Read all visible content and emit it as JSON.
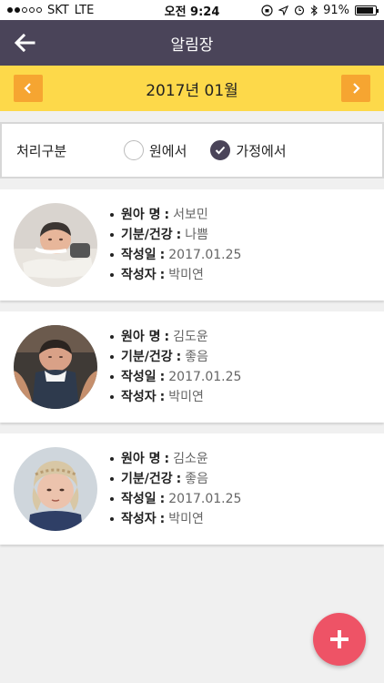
{
  "status_bar": {
    "carrier": "SKT",
    "network": "LTE",
    "time": "오전 9:24",
    "battery_percent": "91%",
    "battery_level": 0.91
  },
  "header": {
    "title": "알림장",
    "back_icon": "arrow-left-icon"
  },
  "month_nav": {
    "label": "2017년 01월",
    "prev_icon": "chevron-left-icon",
    "next_icon": "chevron-right-icon"
  },
  "filter": {
    "label": "처리구분",
    "options": [
      {
        "label": "원에서",
        "checked": false
      },
      {
        "label": "가정에서",
        "checked": true
      }
    ]
  },
  "field_labels": {
    "name": "원아 명",
    "mood": "기분/건강",
    "date": "작성일",
    "author": "작성자"
  },
  "entries": [
    {
      "name": "서보민",
      "mood": "나쁨",
      "date": "2017.01.25",
      "author": "박미연"
    },
    {
      "name": "김도윤",
      "mood": "좋음",
      "date": "2017.01.25",
      "author": "박미연"
    },
    {
      "name": "김소윤",
      "mood": "좋음",
      "date": "2017.01.25",
      "author": "박미연"
    }
  ],
  "fab": {
    "icon": "plus-icon"
  },
  "colors": {
    "header_bg": "#4a4459",
    "month_bar_bg": "#fdd94a",
    "nav_button_bg": "#f6a531",
    "fab_bg": "#ee5366"
  }
}
